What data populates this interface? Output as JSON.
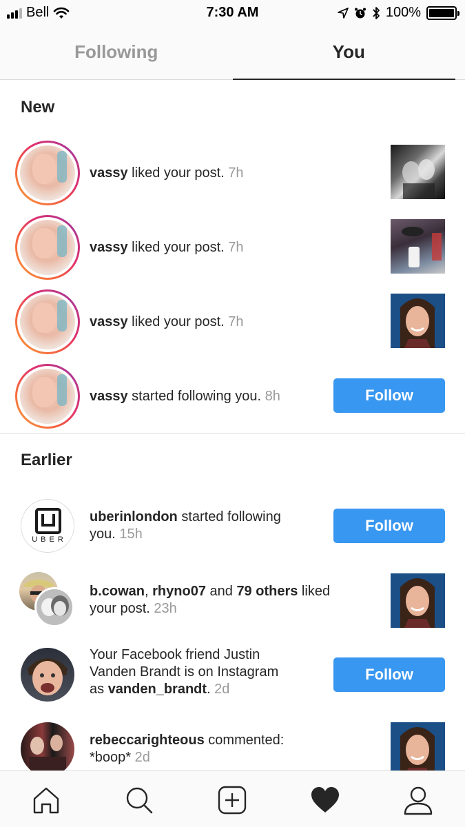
{
  "status_bar": {
    "carrier": "Bell",
    "time": "7:30 AM",
    "battery": "100%"
  },
  "tabs": [
    {
      "label": "Following",
      "active": false
    },
    {
      "label": "You",
      "active": true
    }
  ],
  "sections": {
    "new": "New",
    "earlier": "Earlier"
  },
  "new_items": [
    {
      "user": "vassy",
      "action": " liked your post.",
      "time": "7h"
    },
    {
      "user": "vassy",
      "action": " liked your post.",
      "time": "7h"
    },
    {
      "user": "vassy",
      "action": " liked your post.",
      "time": "7h"
    },
    {
      "user": "vassy",
      "action": " started following you.",
      "time": "8h",
      "button": "Follow"
    }
  ],
  "earlier_items": {
    "uber": {
      "avatar_text": "UBER",
      "user": "uberinlondon",
      "action": " started following",
      "action2": "you.",
      "time": "15h",
      "button": "Follow"
    },
    "likes": {
      "user1": "b.cowan",
      "sep": ", ",
      "user2": "rhyno07",
      "and": " and ",
      "others": "79 others",
      "action": " liked",
      "action2": "your post.",
      "time": "23h"
    },
    "facebook": {
      "line1": "Your Facebook friend Justin",
      "line2": "Vanden Brandt is on Instagram",
      "prefix": "as ",
      "user": "vanden_brandt",
      "suffix": ".",
      "time": "2d",
      "button": "Follow"
    },
    "comment": {
      "user": "rebeccarighteous",
      "action": " commented:",
      "comment": "*boop*",
      "time": "2d"
    }
  },
  "tab_bar": [
    "home-icon",
    "search-icon",
    "add-icon",
    "heart-icon",
    "profile-icon"
  ],
  "colors": {
    "accent": "#3897f0",
    "muted": "#999999",
    "text": "#262626"
  }
}
